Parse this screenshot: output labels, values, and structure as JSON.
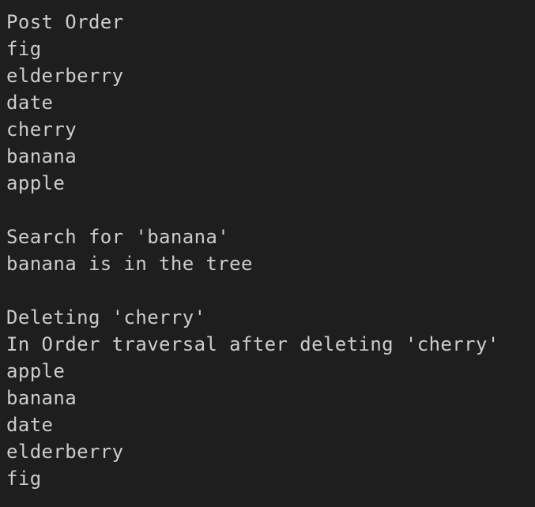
{
  "terminal": {
    "lines": [
      "Post Order",
      "fig",
      "elderberry",
      "date",
      "cherry",
      "banana",
      "apple",
      "",
      "Search for 'banana'",
      "banana is in the tree",
      "",
      "Deleting 'cherry'",
      "In Order traversal after deleting 'cherry'",
      "apple",
      "banana",
      "date",
      "elderberry",
      "fig"
    ]
  }
}
